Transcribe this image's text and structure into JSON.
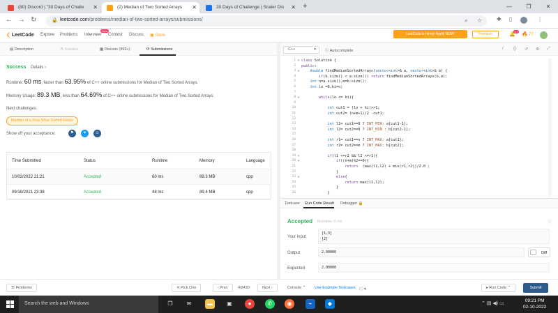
{
  "browser": {
    "tabs": [
      {
        "title": "(80) Discord | \"30 Days of Challe",
        "color": "#e8453c"
      },
      {
        "title": "(2) Median of Two Sorted Arrays",
        "color": "#ffa116"
      },
      {
        "title": "30 Days of Challenge | Scaler Dis",
        "color": "#1a73e8"
      }
    ],
    "url_host": "leetcode.com",
    "url_path": "/problems/median-of-two-sorted-arrays/submissions/"
  },
  "lcnav": {
    "brand": "LeetCode",
    "links": [
      "Explore",
      "Problems",
      "Interview",
      "Contest",
      "Discuss"
    ],
    "store": "Store",
    "new_badge": "New",
    "promo": "LeetCode is hiring! Apply NOW.",
    "premium": "Premium",
    "notif_count": "47",
    "streak": "77"
  },
  "lefttabs": [
    "Description",
    "Solution",
    "Discuss (999+)",
    "Submissions"
  ],
  "result": {
    "status": "Success",
    "details": "Details",
    "runtime_prefix": "Runtime: ",
    "runtime": "60 ms",
    "runtime_mid": ", faster than ",
    "runtime_pct": "63.95%",
    "runtime_suffix": " of C++ online submissions for Median of Two Sorted Arrays.",
    "memory_prefix": "Memory Usage: ",
    "memory": "89.3 MB",
    "memory_mid": ", less than ",
    "memory_pct": "64.69%",
    "memory_suffix": " of C++ online submissions for Median of Two Sorted Arrays.",
    "next_label": "Next challenges:",
    "next_challenge": "Median of a Row Wise Sorted Matrix",
    "showoff": "Show off your acceptance:"
  },
  "table": {
    "headers": [
      "Time Submitted",
      "Status",
      "Runtime",
      "Memory",
      "Language"
    ],
    "rows": [
      [
        "10/02/2022 21:21",
        "Accepted",
        "60 ms",
        "89.3 MB",
        "cpp"
      ],
      [
        "09/19/2021 23:38",
        "Accepted",
        "48 ms",
        "89.4 MB",
        "cpp"
      ]
    ]
  },
  "editor": {
    "language": "C++",
    "autocomplete": "Autocomplete",
    "lines": [
      "class Solution {",
      "public:",
      "    double findMedianSortedArrays(vector<int>& a, vector<int>& b) {",
      "        if(b.size() < a.size()) return findMedianSortedArrays(b,a);",
      "    int n=a.size(),m=b.size();",
      "    int lo =0,hi=n;",
      "",
      "        while(lo <= hi){",
      "",
      "            int cut1 = (lo + hi)>>1;",
      "            int cut2= (n+m+1)/2 -cut1;",
      "",
      "            int l1= cut1==0 ? INT_MIN: a[cut1-1];",
      "            int l2= cut2==0 ? INT_MIN : b[cut2-1];",
      "",
      "            int r1= cut1==n ? INT_MAX: a[cut1];",
      "            int r2= cut2==m ? INT_MAX: b[cut2];",
      "",
      "            if(l1 <=r2 && l2 <=r1){",
      "                if((n+m)%2==0){",
      "                    return  (max(l1,l2) + min(r1,r2))/2.0 ;",
      "                }",
      "                else{",
      "                    return max(l1,l2);",
      "                }",
      "            }"
    ]
  },
  "console": {
    "tabs": [
      "Testcase",
      "Run Code Result",
      "Debugger"
    ],
    "status": "Accepted",
    "runtime": "Runtime: 0 ms",
    "input_label": "Your input",
    "input_lines": [
      "[1,3]",
      "[2]"
    ],
    "output_label": "Output",
    "output": "2.00000",
    "expected_label": "Expected",
    "expected": "2.00000",
    "diff": "Diff"
  },
  "bottombar": {
    "problems": "Problems",
    "pick_one": "Pick One",
    "prev": "Prev",
    "page": "4/2430",
    "next": "Next",
    "console": "Console",
    "use_example": "Use Example Testcases",
    "run_code": "Run Code",
    "submit": "Submit"
  },
  "taskbar": {
    "search_placeholder": "Search the web and Windows",
    "time": "09:21 PM",
    "date": "02-10-2022"
  }
}
